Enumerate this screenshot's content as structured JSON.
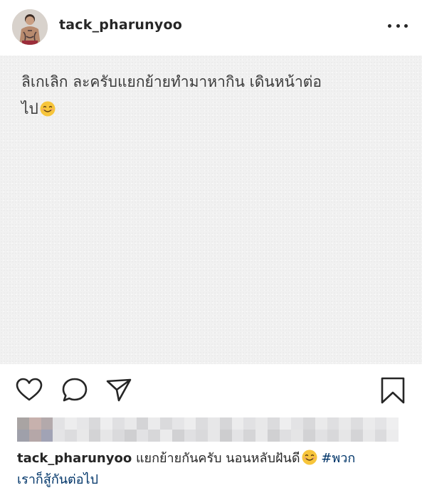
{
  "post": {
    "username": "tack_pharunyoo",
    "image_text_line1": "ลิเกเลิก ละครับแยกย้ายทำมาหากิน เดินหน้าต่อ",
    "image_text_line2": "ไป",
    "image_emoji": "smiling-face-emoji"
  },
  "actions": {
    "like": "heart-icon",
    "comment": "comment-icon",
    "share": "share-icon",
    "save": "bookmark-icon"
  },
  "caption": {
    "username": "tack_pharunyoo",
    "text": "แยกย้ายกันครับ นอนหลับฝันดี",
    "emoji": "smiling-face-emoji",
    "hashtag_part1": "#พวก",
    "hashtag_part2": "เราก็สู้กันต่อไป"
  },
  "colors": {
    "text": "#262626",
    "hashtag": "#003569",
    "post_background": "#f1f1f1"
  }
}
